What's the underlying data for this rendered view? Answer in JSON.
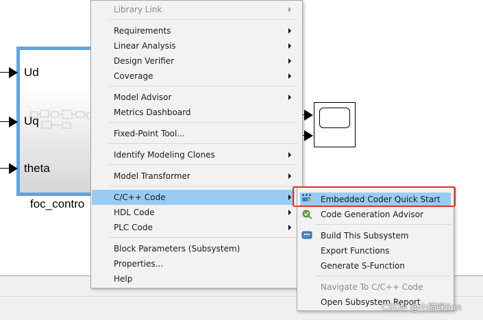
{
  "subsystem": {
    "ports": [
      "Ud",
      "Uq",
      "theta"
    ],
    "name": "foc_contro"
  },
  "context_menu": {
    "items": [
      {
        "label": "Library Link",
        "submenu": true,
        "disabled": true
      },
      {
        "label": "Requirements",
        "submenu": true
      },
      {
        "label": "Linear Analysis",
        "submenu": true
      },
      {
        "label": "Design Verifier",
        "submenu": true
      },
      {
        "label": "Coverage",
        "submenu": true
      },
      {
        "label": "Model Advisor",
        "submenu": true
      },
      {
        "label": "Metrics Dashboard",
        "submenu": false
      },
      {
        "label": "Fixed-Point Tool...",
        "submenu": false
      },
      {
        "label": "Identify Modeling Clones",
        "submenu": true
      },
      {
        "label": "Model Transformer",
        "submenu": true
      },
      {
        "label": "C/C++ Code",
        "submenu": true,
        "highlighted": true
      },
      {
        "label": "HDL Code",
        "submenu": true
      },
      {
        "label": "PLC Code",
        "submenu": true
      },
      {
        "label": "Block Parameters (Subsystem)",
        "submenu": false
      },
      {
        "label": "Properties...",
        "submenu": false
      },
      {
        "label": "Help",
        "submenu": false
      }
    ]
  },
  "code_submenu": {
    "items": [
      {
        "label": "Embedded Coder Quick Start",
        "icon": "quick-start-icon",
        "highlighted": true
      },
      {
        "label": "Code Generation Advisor",
        "icon": "advisor-icon"
      },
      {
        "label": "Build This Subsystem",
        "icon": "build-icon"
      },
      {
        "label": "Export Functions"
      },
      {
        "label": "Generate S-Function"
      },
      {
        "label": "Navigate To C/C++ Code",
        "disabled": true
      },
      {
        "label": "Open Subsystem Report"
      }
    ]
  },
  "watermark": "CSDN @小猫咪lion",
  "colors": {
    "menu_highlight": "#99ccf2",
    "selection_border": "#5aa6e6",
    "annotation_box": "#e0302a"
  }
}
